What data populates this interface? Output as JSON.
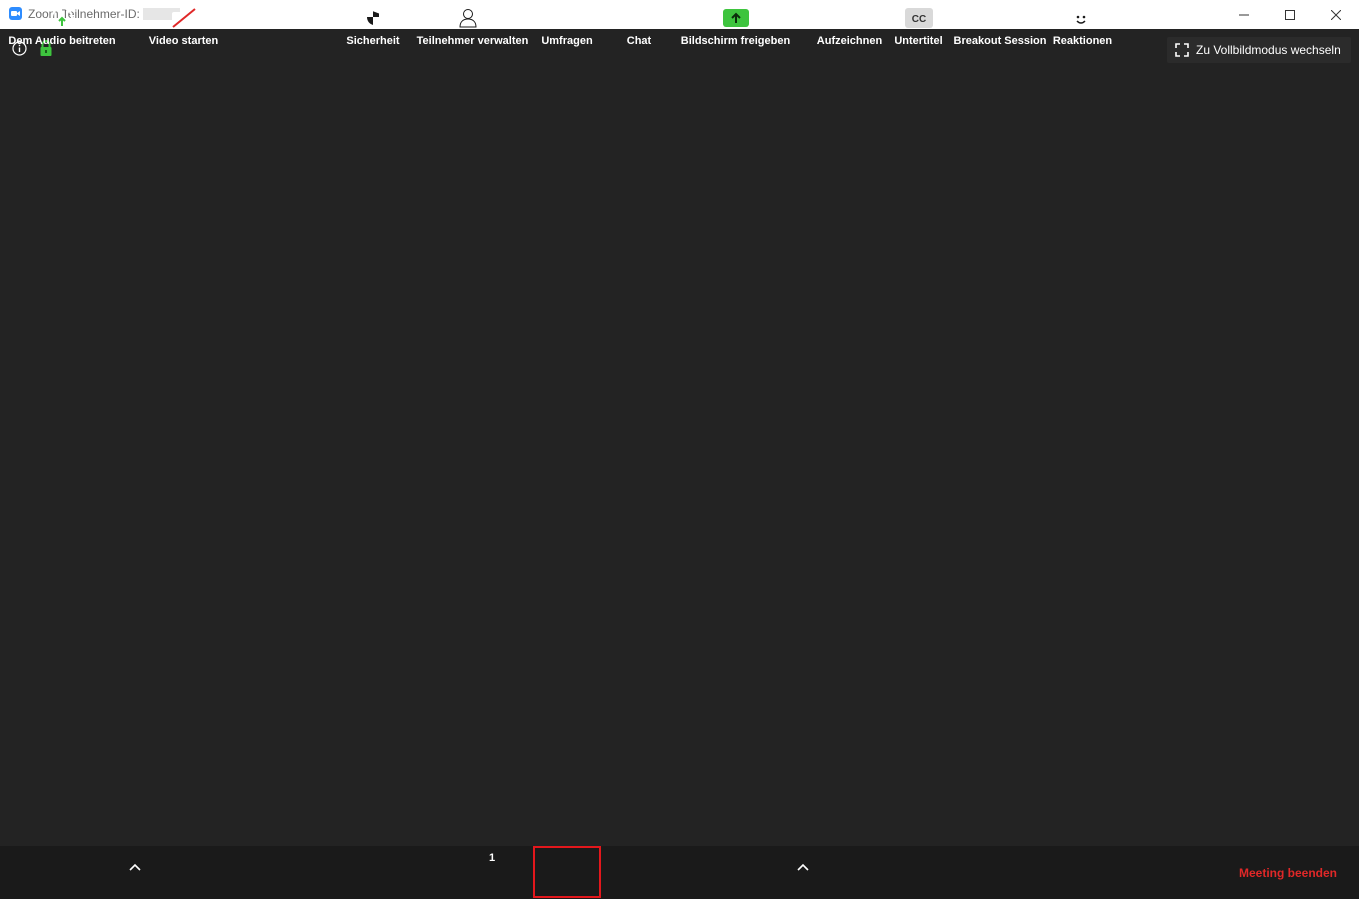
{
  "window": {
    "title": "Zoom Teilnehmer-ID:"
  },
  "meeting": {
    "fullscreen_label": "Zu Vollbildmodus wechseln"
  },
  "toolbar": {
    "audio_label": "Dem Audio beitreten",
    "video_label": "Video starten",
    "security_label": "Sicherheit",
    "participants_label": "Teilnehmer verwalten",
    "participants_count": "1",
    "polls_label": "Umfragen",
    "chat_label": "Chat",
    "share_label": "Bildschirm freigeben",
    "record_label": "Aufzeichnen",
    "captions_label": "Untertitel",
    "captions_icon_text": "CC",
    "breakout_label": "Breakout Session",
    "reactions_label": "Reaktionen",
    "end_label": "Meeting beenden"
  },
  "colors": {
    "accent_blue": "#2d8cff",
    "share_green": "#3ec43e",
    "end_red": "#e02828",
    "highlight_red": "#e3171c"
  }
}
